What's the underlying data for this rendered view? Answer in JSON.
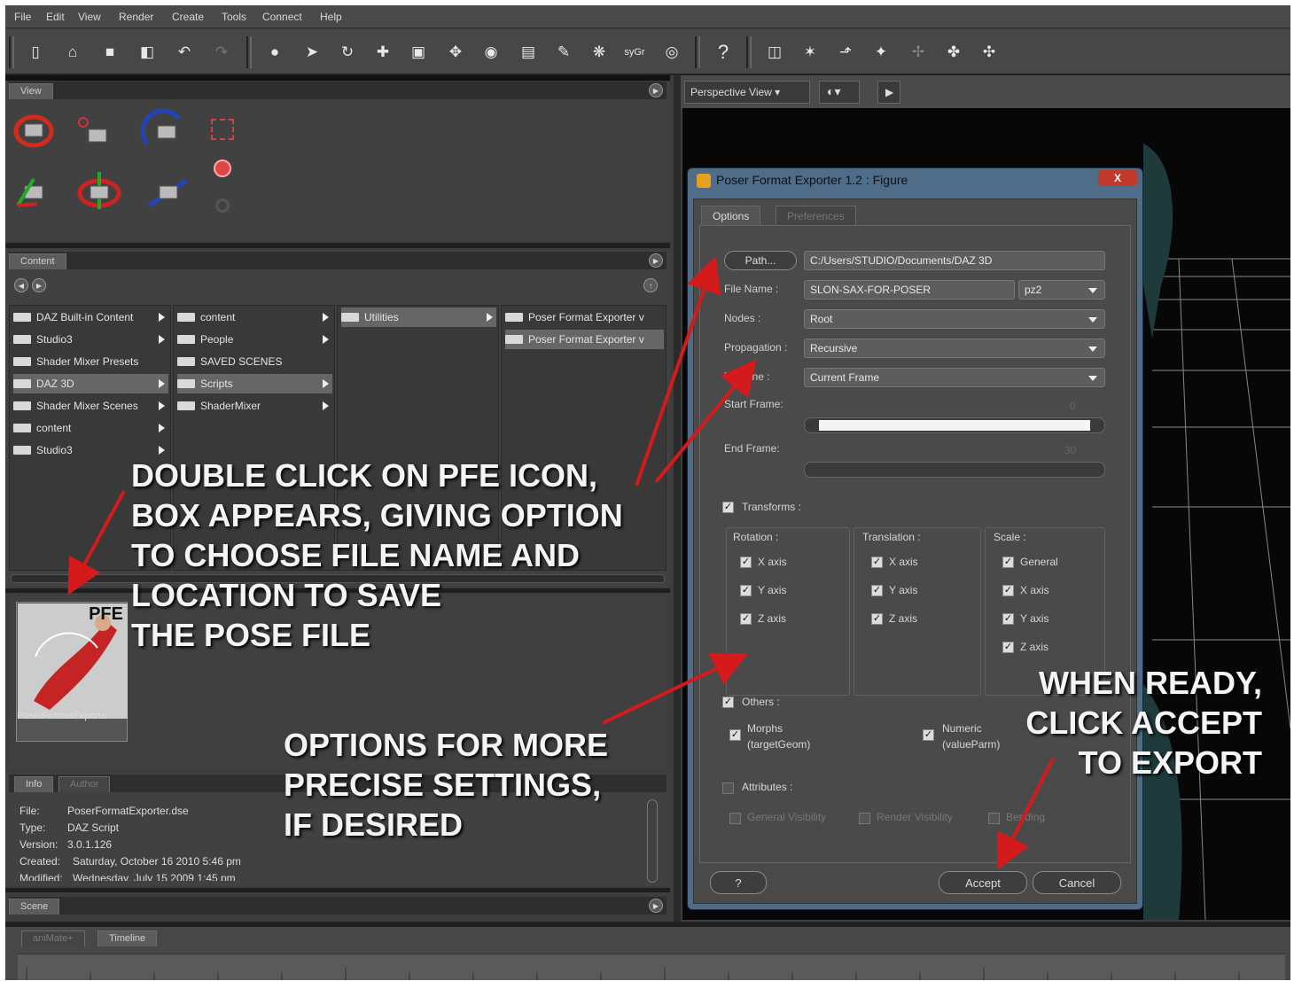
{
  "menu": [
    "File",
    "Edit",
    "View",
    "Render",
    "Create",
    "Tools",
    "Connect",
    "Help"
  ],
  "toolbar_right_label": "syGr",
  "view_panel": {
    "tab": "View"
  },
  "content_panel": {
    "tab": "Content",
    "col1": [
      "DAZ Built-in Content",
      "Studio3",
      "Shader Mixer Presets",
      "DAZ 3D",
      "Shader Mixer Scenes",
      "content",
      "Studio3"
    ],
    "col2": [
      "content",
      "People",
      "SAVED SCENES",
      "Scripts",
      "ShaderMixer"
    ],
    "col3": [
      "Utilities"
    ],
    "col4": [
      "Poser Format Exporter v",
      "Poser Format Exporter v"
    ],
    "thumb_badge": "PFE",
    "thumb_caption": "PoserFormatExporte"
  },
  "info_panel": {
    "tabs": [
      "Info",
      "Author"
    ],
    "lines": [
      {
        "k": "File:",
        "v": "PoserFormatExporter.dse"
      },
      {
        "k": "Type:",
        "v": "DAZ Script"
      },
      {
        "k": "Version:",
        "v": "3.0.1.126"
      },
      {
        "k": "Created:",
        "v": "Saturday, October 16 2010 5:46 pm"
      },
      {
        "k": "Modified:",
        "v": "Wednesday, July 15 2009 1:45 pm"
      }
    ]
  },
  "scene_tab": "Scene",
  "bottom_tabs": [
    "aniMate+",
    "Timeline"
  ],
  "viewport": {
    "view_label": "Perspective View"
  },
  "dialog": {
    "title": "Poser Format Exporter 1.2 : Figure",
    "close": "X",
    "tabs": [
      "Options",
      "Preferences"
    ],
    "path_button": "Path...",
    "path_value": "C:/Users/STUDIO/Documents/DAZ 3D",
    "file_name_label": "File Name :",
    "file_name_value": "SLON-SAX-FOR-POSER",
    "ext_value": "pz2",
    "nodes_label": "Nodes :",
    "nodes_value": "Root",
    "propagation_label": "Propagation :",
    "propagation_value": "Recursive",
    "timeline_label": "Timeline :",
    "timeline_value": "Current Frame",
    "start_frame_label": "Start Frame:",
    "start_frame_value": "0",
    "end_frame_label": "End Frame:",
    "end_frame_value": "30",
    "transforms_label": "Transforms :",
    "rotation_label": "Rotation :",
    "translation_label": "Translation :",
    "scale_label": "Scale :",
    "rotation_items": [
      "X axis",
      "Y axis",
      "Z axis"
    ],
    "translation_items": [
      "X axis",
      "Y axis",
      "Z axis"
    ],
    "scale_items": [
      "General",
      "X axis",
      "Y axis",
      "Z axis"
    ],
    "others_label": "Others :",
    "morphs_label": "Morphs",
    "morphs_sub": "(targetGeom)",
    "numeric_label": "Numeric",
    "numeric_sub": "(valueParm)",
    "attributes_label": "Attributes :",
    "attr_items": [
      "General Visibility",
      "Render Visibility",
      "Bending"
    ],
    "help_button": "?",
    "accept_button": "Accept",
    "cancel_button": "Cancel"
  },
  "annotations": {
    "a1": [
      "DOUBLE CLICK ON PFE ICON,",
      "BOX APPEARS, GIVING OPTION",
      "TO CHOOSE FILE NAME AND",
      "LOCATION TO SAVE",
      "THE POSE FILE"
    ],
    "a2": [
      "OPTIONS FOR MORE",
      "PRECISE SETTINGS,",
      "IF DESIRED"
    ],
    "a3": [
      "WHEN READY,",
      "CLICK ACCEPT",
      "TO EXPORT"
    ]
  },
  "colors": {
    "arrow": "#d41a1a",
    "dialog_frame": "#4f6d88"
  }
}
